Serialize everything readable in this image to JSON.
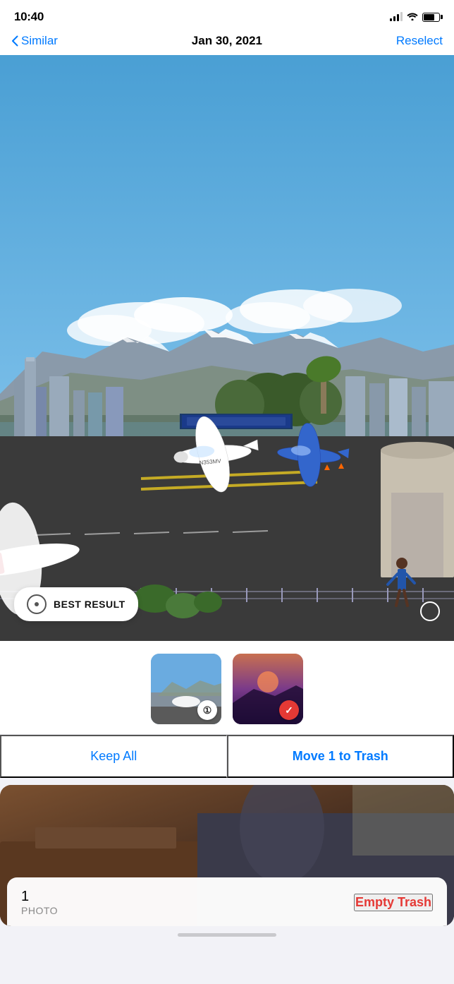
{
  "status": {
    "time": "10:40",
    "location_active": true
  },
  "navigation": {
    "back_label": "Similar",
    "title": "Jan 30, 2021",
    "action_label": "Reselect"
  },
  "photo": {
    "best_result_label": "BEST RESULT"
  },
  "thumbnails": [
    {
      "id": "thumb1",
      "type": "airport",
      "badge_type": "number",
      "badge_value": "①"
    },
    {
      "id": "thumb2",
      "type": "sunset",
      "badge_type": "check"
    }
  ],
  "actions": {
    "keep_all_label": "Keep All",
    "move_trash_label": "Move 1 to Trash"
  },
  "trash_bar": {
    "count": "1",
    "photo_label": "PHOTO",
    "empty_label": "Empty Trash"
  }
}
